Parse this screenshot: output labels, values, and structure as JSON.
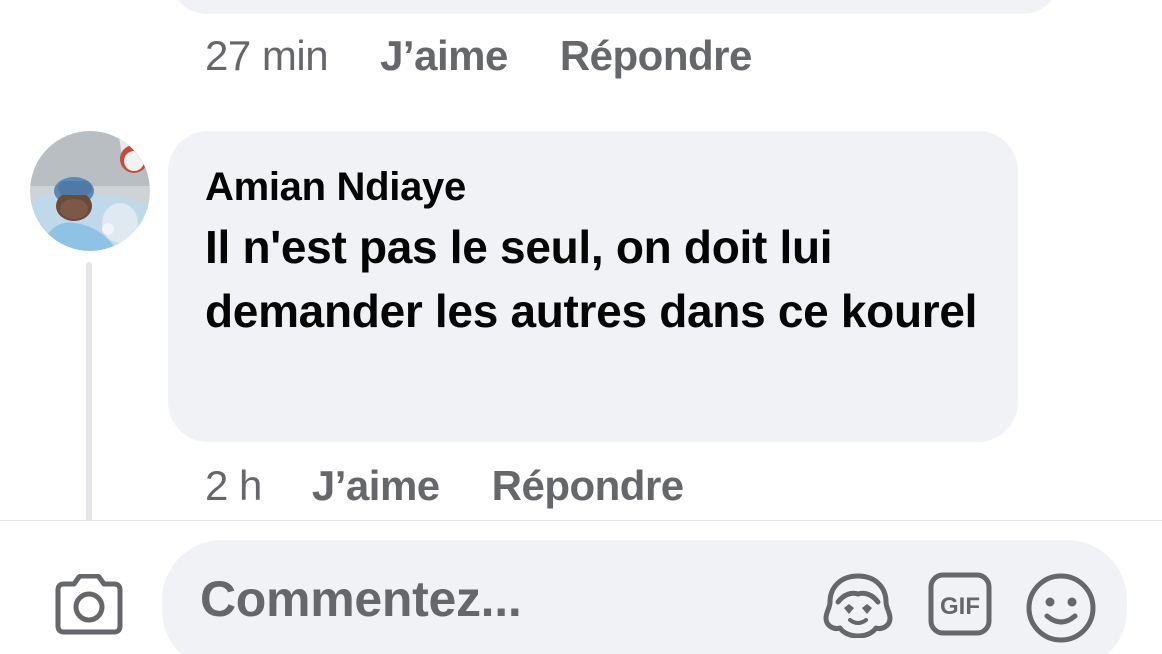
{
  "previous_comment": {
    "time": "27 min",
    "like_label": "J’aime",
    "reply_label": "Répondre"
  },
  "comment": {
    "author": "Amian Ndiaye",
    "text": "Il n'est pas le seul, on doit lui demander les autres dans ce kourel",
    "time": "2 h",
    "like_label": "J’aime",
    "reply_label": "Répondre",
    "avatar": "baby-photo-avatar"
  },
  "composer": {
    "placeholder": "Commentez...",
    "icons": [
      "camera-icon",
      "avatar-sticker-icon",
      "gif-icon",
      "emoji-icon"
    ],
    "gif_text": "GIF"
  },
  "colors": {
    "bubble": "#f0f2f5",
    "secondary_text": "#65676b",
    "primary_text": "#050505"
  }
}
